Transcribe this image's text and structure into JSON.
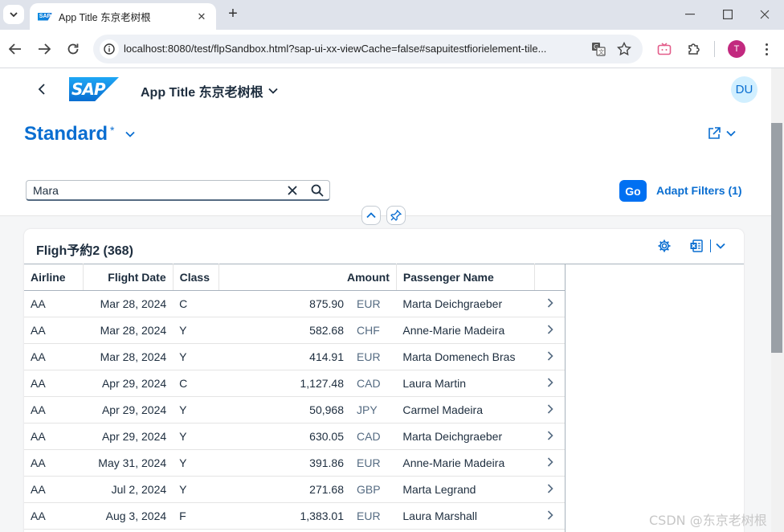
{
  "browser": {
    "tab_title": "App Title 东京老树根",
    "tab_favicon": "SAP",
    "url": "localhost:8080/test/flpSandbox.html?sap-ui-xx-viewCache=false#sapuitestfiorielement-tile...",
    "profile_initial": "T"
  },
  "shell": {
    "logo_text": "SAP",
    "app_title": "App Title 东京老树根",
    "avatar_initials": "DU"
  },
  "header": {
    "variant_name": "Standard",
    "variant_dirty": "*"
  },
  "filter": {
    "search_value": "Mara",
    "go_label": "Go",
    "adapt_filters_label": "Adapt Filters (1)"
  },
  "table": {
    "title": "Fligh予約2 (368)",
    "columns": {
      "airline": "Airline",
      "flight_date": "Flight Date",
      "class": "Class",
      "amount": "Amount",
      "passenger": "Passenger Name"
    },
    "rows": [
      {
        "airline": "AA",
        "date": "Mar 28, 2024",
        "cls": "C",
        "amount": "875.90",
        "currency": "EUR",
        "passenger": "Marta Deichgraeber"
      },
      {
        "airline": "AA",
        "date": "Mar 28, 2024",
        "cls": "Y",
        "amount": "582.68",
        "currency": "CHF",
        "passenger": "Anne-Marie Madeira"
      },
      {
        "airline": "AA",
        "date": "Mar 28, 2024",
        "cls": "Y",
        "amount": "414.91",
        "currency": "EUR",
        "passenger": "Marta Domenech Bras"
      },
      {
        "airline": "AA",
        "date": "Apr 29, 2024",
        "cls": "C",
        "amount": "1,127.48",
        "currency": "CAD",
        "passenger": "Laura Martin"
      },
      {
        "airline": "AA",
        "date": "Apr 29, 2024",
        "cls": "Y",
        "amount": "50,968",
        "currency": "JPY",
        "passenger": "Carmel Madeira"
      },
      {
        "airline": "AA",
        "date": "Apr 29, 2024",
        "cls": "Y",
        "amount": "630.05",
        "currency": "CAD",
        "passenger": "Marta Deichgraeber"
      },
      {
        "airline": "AA",
        "date": "May 31, 2024",
        "cls": "Y",
        "amount": "391.86",
        "currency": "EUR",
        "passenger": "Anne-Marie Madeira"
      },
      {
        "airline": "AA",
        "date": "Jul 2, 2024",
        "cls": "Y",
        "amount": "271.68",
        "currency": "GBP",
        "passenger": "Marta Legrand"
      },
      {
        "airline": "AA",
        "date": "Aug 3, 2024",
        "cls": "F",
        "amount": "1,383.01",
        "currency": "EUR",
        "passenger": "Laura Marshall"
      }
    ]
  },
  "watermark": "CSDN @东京老树根",
  "colors": {
    "brand": "#0a6ed1",
    "go_button": "#0070f2",
    "avatar_bg": "#d1efff"
  }
}
